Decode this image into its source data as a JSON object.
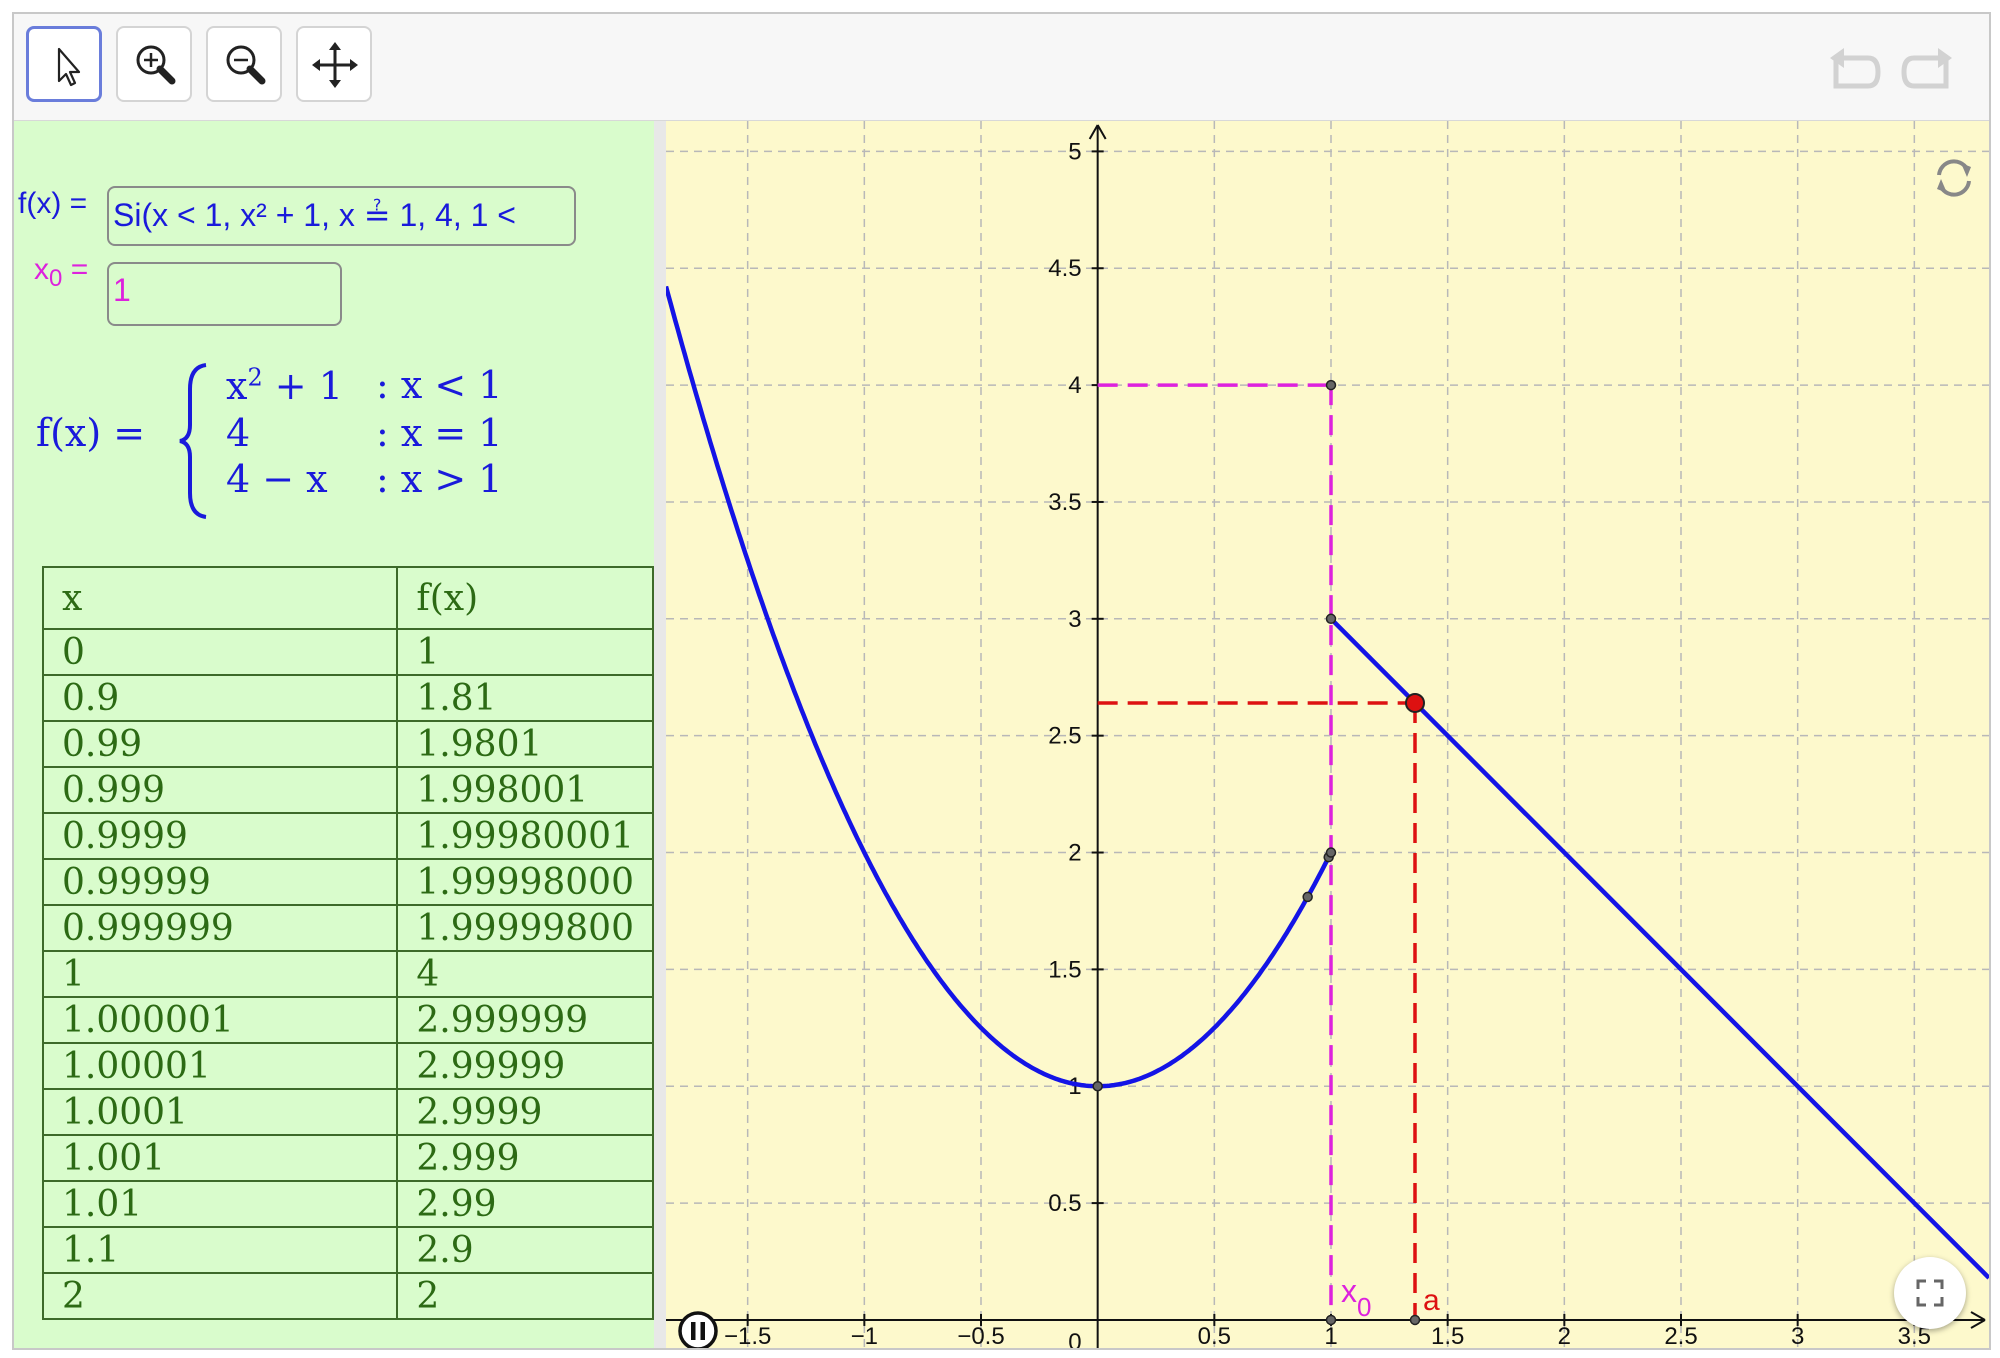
{
  "toolbar": {
    "tools": [
      {
        "name": "move",
        "icon": "pointer-arrow-icon"
      },
      {
        "name": "zoom_in",
        "icon": "zoom-in-icon"
      },
      {
        "name": "zoom_out",
        "icon": "zoom-out-icon"
      },
      {
        "name": "pan",
        "icon": "move-arrows-icon"
      }
    ],
    "undo_icon": "undo-icon",
    "redo_icon": "redo-icon"
  },
  "algebra": {
    "f_label": "f(x) =",
    "f_input": "Si(x < 1, x² + 1, x ≟ 1, 4, 1 <",
    "x0_label_main": "x",
    "x0_label_sub": "0",
    "x0_label_eq": "=",
    "x0_value": "1",
    "piecewise": {
      "lhs": "f(x) =",
      "cases": [
        {
          "expr_base": "x",
          "expr_sup": "2",
          "expr_rest": " + 1",
          "cond": ": x < 1"
        },
        {
          "expr_base": "4",
          "expr_sup": "",
          "expr_rest": "",
          "cond": ": x = 1"
        },
        {
          "expr_base": "4 − x",
          "expr_sup": "",
          "expr_rest": "",
          "cond": ": x > 1"
        }
      ]
    },
    "table": {
      "headers": [
        "x",
        "f(x)"
      ],
      "rows": [
        [
          "0",
          "1"
        ],
        [
          "0.9",
          "1.81"
        ],
        [
          "0.99",
          "1.9801"
        ],
        [
          "0.999",
          "1.998001"
        ],
        [
          "0.9999",
          "1.99980001"
        ],
        [
          "0.99999",
          "1.99998000"
        ],
        [
          "0.999999",
          "1.99999800"
        ],
        [
          "1",
          "4"
        ],
        [
          "1.000001",
          "2.999999"
        ],
        [
          "1.00001",
          "2.99999"
        ],
        [
          "1.0001",
          "2.9999"
        ],
        [
          "1.001",
          "2.999"
        ],
        [
          "1.01",
          "2.99"
        ],
        [
          "1.1",
          "2.9"
        ],
        [
          "2",
          "2"
        ]
      ]
    }
  },
  "graph": {
    "x_ticks": [
      "−1.5",
      "−1",
      "−0.5",
      "0.5",
      "1",
      "1.5",
      "2",
      "2.5",
      "3",
      "3.5"
    ],
    "x_tick_values": [
      -1.5,
      -1,
      -0.5,
      0.5,
      1,
      1.5,
      2,
      2.5,
      3,
      3.5
    ],
    "y_ticks": [
      "0.5",
      "1",
      "1.5",
      "2",
      "2.5",
      "3",
      "3.5",
      "4",
      "4.5",
      "5"
    ],
    "y_tick_values": [
      0.5,
      1,
      1.5,
      2,
      2.5,
      3,
      3.5,
      4,
      4.5,
      5
    ],
    "origin_label": "0",
    "xlim": [
      -1.85,
      3.82
    ],
    "ylim": [
      -0.12,
      5.13
    ],
    "x0": 1,
    "x0_label_main": "x",
    "x0_label_sub": "0",
    "point_a": {
      "x": 1.36,
      "y": 2.64,
      "label": "a"
    },
    "table_points": [
      {
        "x": 0,
        "y": 1
      },
      {
        "x": 0.9,
        "y": 1.81
      },
      {
        "x": 0.99,
        "y": 1.9801
      },
      {
        "x": 1,
        "y": 4
      },
      {
        "x": 1,
        "y": 3
      },
      {
        "x": 1,
        "y": 2
      }
    ],
    "colors": {
      "curve": "#1414e6",
      "x0_line": "#dd22dd",
      "a_line": "#dd1111",
      "grid": "#b8b8b8"
    },
    "icons": {
      "reset": "refresh-icon",
      "fullscreen": "fullscreen-icon",
      "pause": "pause-icon"
    }
  }
}
